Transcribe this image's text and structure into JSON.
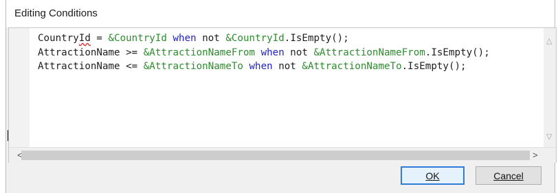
{
  "dialog": {
    "title": "Editing Conditions"
  },
  "editor": {
    "lines": [
      [
        {
          "t": "Country",
          "c": "plain"
        },
        {
          "t": "Id",
          "c": "err"
        },
        {
          "t": " = ",
          "c": "plain"
        },
        {
          "t": "&CountryId",
          "c": "var"
        },
        {
          "t": " ",
          "c": "plain"
        },
        {
          "t": "when",
          "c": "kw"
        },
        {
          "t": " not ",
          "c": "plain"
        },
        {
          "t": "&CountryId",
          "c": "var"
        },
        {
          "t": ".IsEmpty();",
          "c": "plain"
        }
      ],
      [
        {
          "t": "AttractionName >= ",
          "c": "plain"
        },
        {
          "t": "&AttractionNameFrom",
          "c": "var"
        },
        {
          "t": " ",
          "c": "plain"
        },
        {
          "t": "when",
          "c": "kw"
        },
        {
          "t": " not ",
          "c": "plain"
        },
        {
          "t": "&AttractionNameFrom",
          "c": "var"
        },
        {
          "t": ".IsEmpty();",
          "c": "plain"
        }
      ],
      [
        {
          "t": "AttractionName <= ",
          "c": "plain"
        },
        {
          "t": "&AttractionNameTo",
          "c": "var"
        },
        {
          "t": " ",
          "c": "plain"
        },
        {
          "t": "when",
          "c": "kw"
        },
        {
          "t": " not ",
          "c": "plain"
        },
        {
          "t": "&AttractionNameTo",
          "c": "var"
        },
        {
          "t": ".IsEmpty();",
          "c": "plain"
        }
      ]
    ]
  },
  "buttons": {
    "ok_label": "OK",
    "cancel_label": "Cancel"
  },
  "colors": {
    "keyword": "#1f1fbf",
    "variable": "#2e8b2e",
    "error_underline": "#e03030",
    "default_button_border": "#2f7bd8"
  },
  "icons": {
    "scroll_up": "chevron-up-icon",
    "scroll_down": "chevron-down-icon",
    "scroll_left": "chevron-left-icon",
    "scroll_right": "chevron-right-icon"
  }
}
